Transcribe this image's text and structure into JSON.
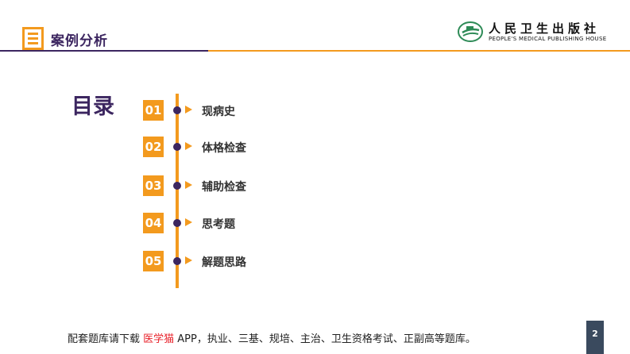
{
  "header": {
    "title": "案例分析",
    "icon": "list-menu-icon"
  },
  "logo": {
    "icon": "publisher-book-emblem-icon",
    "name_cn": "人民卫生出版社",
    "name_en": "PEOPLE'S MEDICAL PUBLISHING HOUSE"
  },
  "toc": {
    "title": "目录",
    "items": [
      {
        "number": "01",
        "label": "现病史"
      },
      {
        "number": "02",
        "label": "体格检查"
      },
      {
        "number": "03",
        "label": "辅助检查"
      },
      {
        "number": "04",
        "label": "思考题"
      },
      {
        "number": "05",
        "label": "解题思路"
      }
    ]
  },
  "footer": {
    "prefix": "配套题库请下载 ",
    "highlight": "医学猫",
    "suffix": " APP，执业、三基、规培、主治、卫生资格考试、正副高等题库。"
  },
  "page_number": "2",
  "colors": {
    "accent_orange": "#f39a1e",
    "brand_purple": "#3c2660",
    "logo_green": "#2e8b57",
    "highlight_red": "#e8212a",
    "page_badge": "#3a4a5e"
  }
}
